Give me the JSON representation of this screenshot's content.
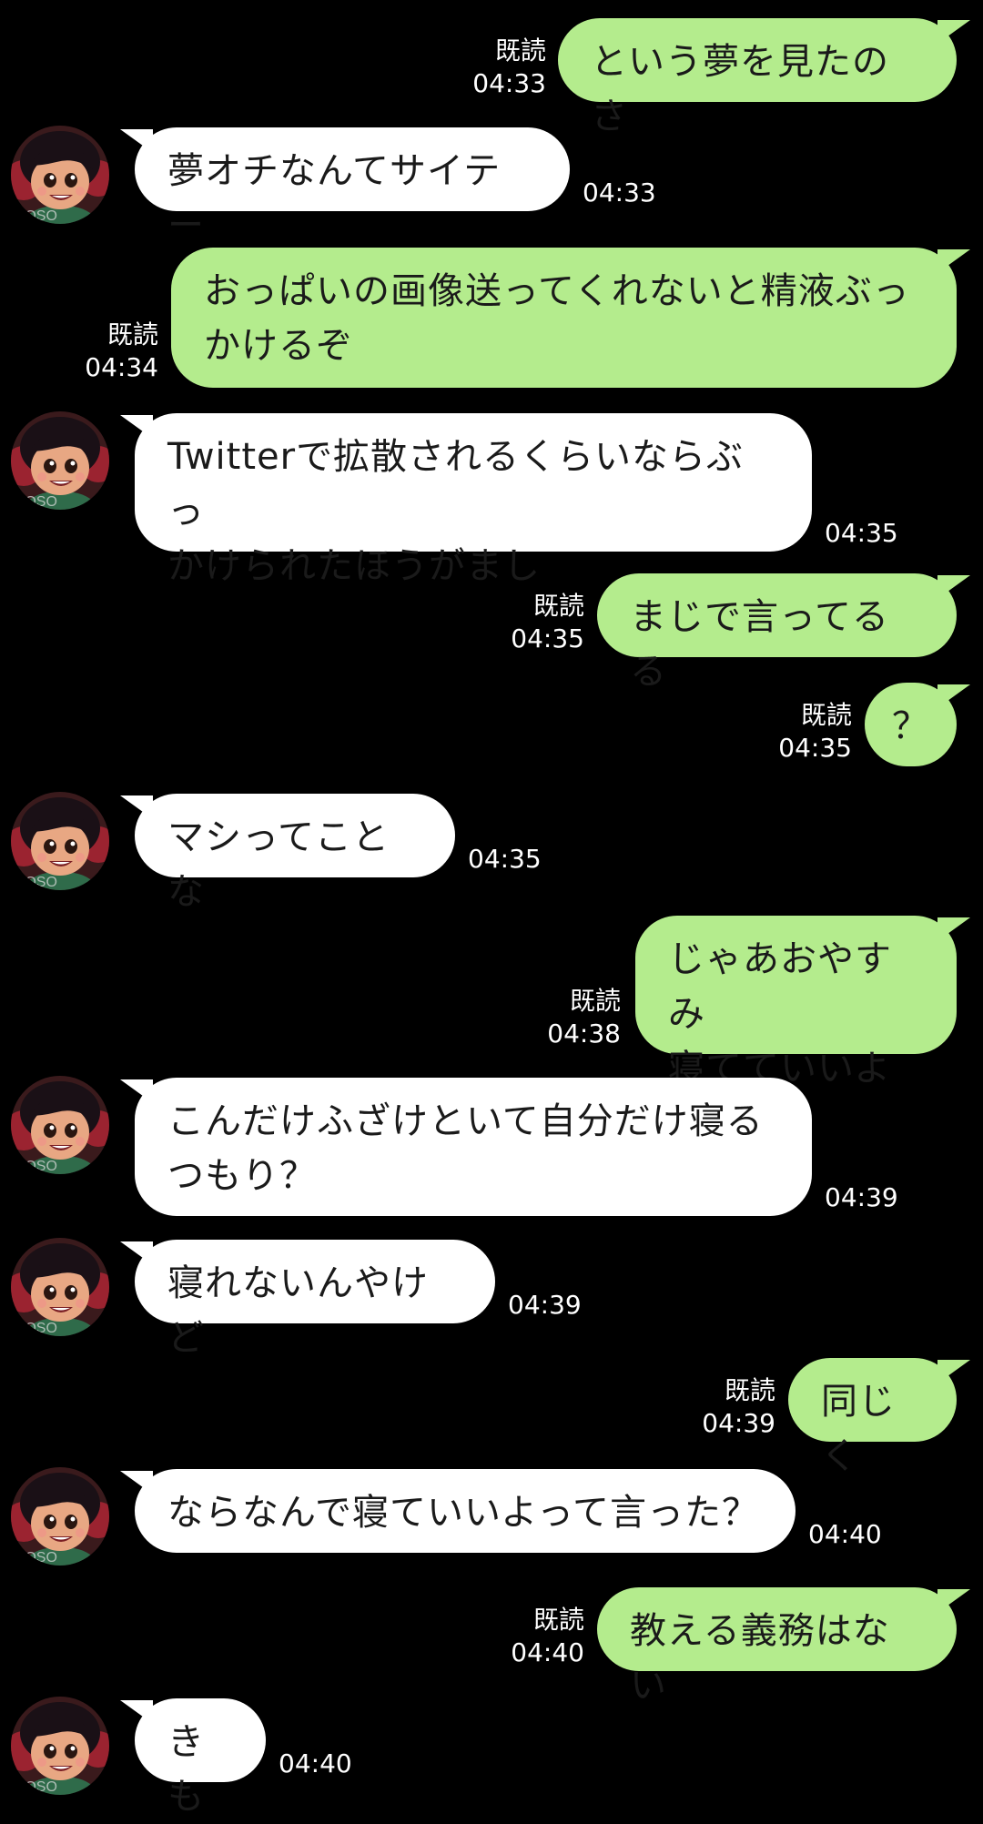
{
  "chat": {
    "read_label": "既読",
    "avatar_watermark": "MOSO",
    "messages": [
      {
        "side": "out",
        "text": "という夢を見たのさ",
        "time": "04:33",
        "read": true
      },
      {
        "side": "in",
        "text": "夢オチなんてサイテー",
        "time": "04:33"
      },
      {
        "side": "out",
        "text": "おっぱいの画像送ってくれないと精液ぶっ\nかけるぞ",
        "time": "04:34",
        "read": true
      },
      {
        "side": "in",
        "text": "Twitterで拡散されるくらいならぶっ\nかけられたほうがまし",
        "time": "04:35"
      },
      {
        "side": "out",
        "text": "まじで言ってるる",
        "time": "04:35",
        "read": true
      },
      {
        "side": "out",
        "text": "？",
        "time": "04:35",
        "read": true
      },
      {
        "side": "in",
        "text": "マシってことな",
        "time": "04:35"
      },
      {
        "side": "out",
        "text": "じゃあおやすみ\n寝てていいよ",
        "time": "04:38",
        "read": true
      },
      {
        "side": "in",
        "text": "こんだけふざけといて自分だけ寝る\nつもり？",
        "time": "04:39"
      },
      {
        "side": "in",
        "text": "寝れないんやけど",
        "time": "04:39"
      },
      {
        "side": "out",
        "text": "同じく",
        "time": "04:39",
        "read": true
      },
      {
        "side": "in",
        "text": "ならなんで寝ていいよって言った？",
        "time": "04:40"
      },
      {
        "side": "out",
        "text": "教える義務はない",
        "time": "04:40",
        "read": true
      },
      {
        "side": "in",
        "text": "きも",
        "time": "04:40"
      }
    ]
  }
}
